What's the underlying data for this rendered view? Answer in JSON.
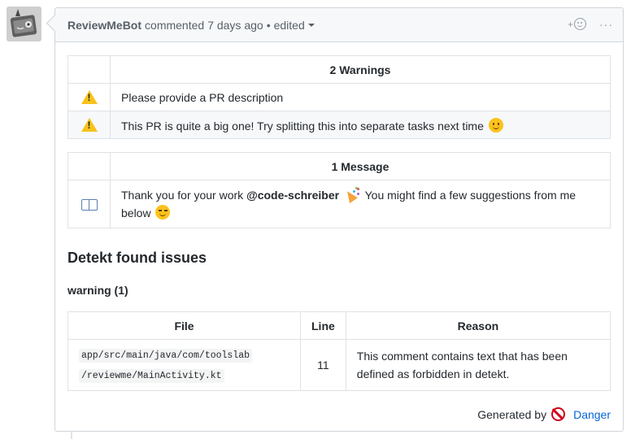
{
  "comment": {
    "author": "ReviewMeBot",
    "action": "commented",
    "time": "7 days ago",
    "separator": "•",
    "edited": "edited",
    "react_plus": "+",
    "more": "···"
  },
  "warnings": {
    "header": "2 Warnings",
    "rows": [
      {
        "icon": "warning-icon",
        "text": "Please provide a PR description"
      },
      {
        "icon": "warning-icon",
        "text": "This PR is quite a big one! Try splitting this into separate tasks next time"
      }
    ]
  },
  "messages": {
    "header": "1 Message",
    "row": {
      "icon": "book-icon",
      "text_before": "Thank you for your work ",
      "mention": "@code-schreiber",
      "text_after": " You might find a few suggestions from me below"
    }
  },
  "detekt": {
    "title": "Detekt found issues",
    "subtitle": "warning (1)",
    "columns": [
      "File",
      "Line",
      "Reason"
    ],
    "rows": [
      {
        "file_line1": "app/src/main/java/com/toolslab",
        "file_line2": "/reviewme/MainActivity.kt",
        "line": "11",
        "reason": "This comment contains text that has been defined as forbidden in detekt."
      }
    ]
  },
  "footer": {
    "generated_by": "Generated by",
    "icon": "no-entry-icon",
    "link": "Danger"
  },
  "colors": {
    "link": "#0366d6",
    "warning": "#f7c31a",
    "danger": "#d0021b",
    "border": "#d1d5da"
  }
}
